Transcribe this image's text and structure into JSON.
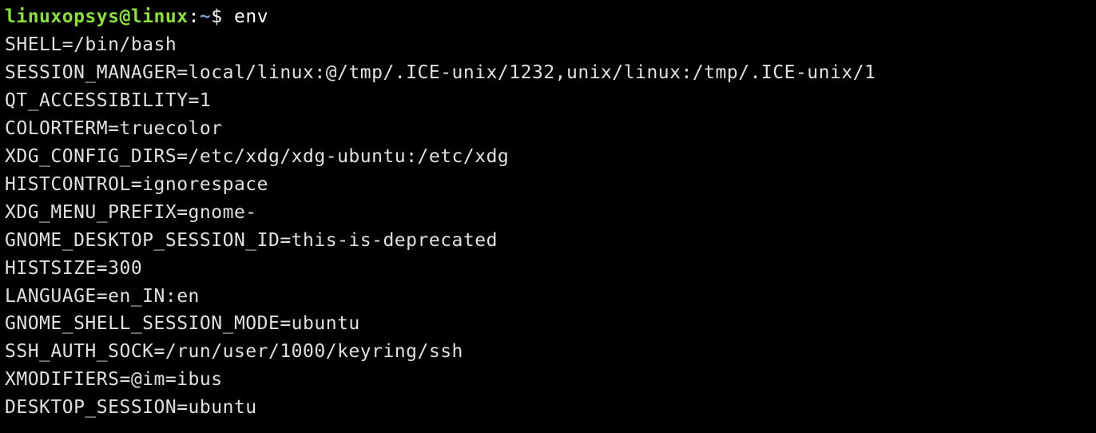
{
  "prompt": {
    "user_host": "linuxopsys@linux",
    "colon": ":",
    "path": "~",
    "dollar": "$",
    "command": "env"
  },
  "output": {
    "line0": "SHELL=/bin/bash",
    "line1": "SESSION_MANAGER=local/linux:@/tmp/.ICE-unix/1232,unix/linux:/tmp/.ICE-unix/1",
    "line2": "QT_ACCESSIBILITY=1",
    "line3": "COLORTERM=truecolor",
    "line4": "XDG_CONFIG_DIRS=/etc/xdg/xdg-ubuntu:/etc/xdg",
    "line5": "HISTCONTROL=ignorespace",
    "line6": "XDG_MENU_PREFIX=gnome-",
    "line7": "GNOME_DESKTOP_SESSION_ID=this-is-deprecated",
    "line8": "HISTSIZE=300",
    "line9": "LANGUAGE=en_IN:en",
    "line10": "GNOME_SHELL_SESSION_MODE=ubuntu",
    "line11": "SSH_AUTH_SOCK=/run/user/1000/keyring/ssh",
    "line12": "XMODIFIERS=@im=ibus",
    "line13": "DESKTOP_SESSION=ubuntu"
  }
}
